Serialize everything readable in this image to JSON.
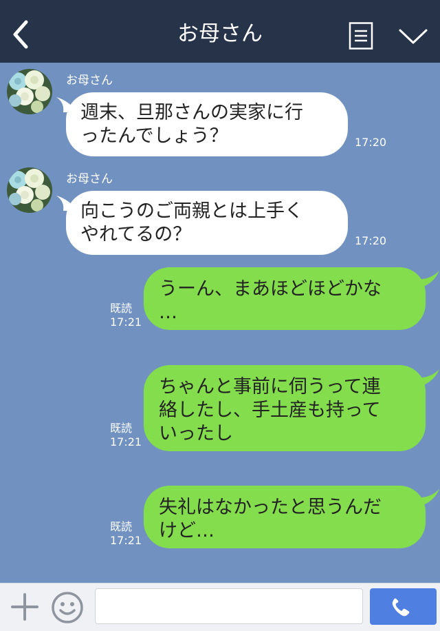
{
  "header": {
    "title": "お母さん",
    "back_icon": "chevron-left-icon",
    "menu_icon": "notes-icon",
    "collapse_icon": "chevron-down-icon",
    "background": "#263349"
  },
  "chat": {
    "background": "#7192c0",
    "messages": [
      {
        "direction": "in",
        "sender": "お母さん",
        "lines": [
          "週末、旦那さんの実家に行",
          "ったんでしょう？"
        ],
        "time": "17:20"
      },
      {
        "direction": "in",
        "sender": "お母さん",
        "lines": [
          "向こうのご両親とは上手く",
          "やれてるの？"
        ],
        "time": "17:20"
      },
      {
        "direction": "out",
        "lines": [
          "うーん、まあほどほどかな",
          "…"
        ],
        "read": "既読",
        "time": "17:21"
      },
      {
        "direction": "out",
        "lines": [
          "ちゃんと事前に伺うって連",
          "絡したし、手土産も持って",
          "いったし"
        ],
        "read": "既読",
        "time": "17:21"
      },
      {
        "direction": "out",
        "lines": [
          "失礼はなかったと思うんだ",
          "けど…"
        ],
        "read": "既読",
        "time": "17:21"
      }
    ]
  },
  "footer": {
    "plus_icon": "plus-icon",
    "emoji_icon": "smiley-icon",
    "input_value": "",
    "call_icon": "phone-icon",
    "call_color": "#4f7fe0"
  },
  "colors": {
    "outgoing_bubble": "#84dd4c",
    "incoming_bubble": "#ffffff"
  }
}
